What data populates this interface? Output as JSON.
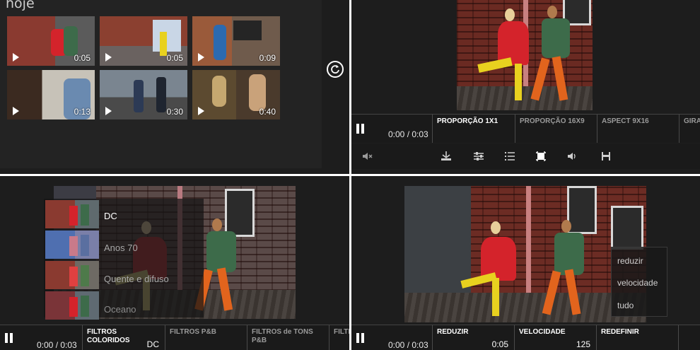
{
  "gallery": {
    "title": "hoje",
    "videos": [
      {
        "duration": "0:05"
      },
      {
        "duration": "0:05"
      },
      {
        "duration": "0:09"
      },
      {
        "duration": "0:13"
      },
      {
        "duration": "0:30"
      },
      {
        "duration": "0:40"
      }
    ],
    "refresh_icon": "refresh-icon"
  },
  "crop_editor": {
    "time": "0:00 / 0:03",
    "options": [
      "PROPORÇÃO 1X1",
      "PROPORÇÃO 16X9",
      "ASPECT 9X16",
      "GIRA"
    ],
    "tools": [
      "mute-icon",
      "trim-icon",
      "adjust-icon",
      "list-icon",
      "crop-icon",
      "volume-icon",
      "save-icon"
    ]
  },
  "filter_editor": {
    "time": "0:00 / 0:03",
    "filters": [
      "DC",
      "Anos 70",
      "Quente e difuso",
      "Oceano"
    ],
    "tabs": [
      {
        "label": "FILTROS COLORIDOS",
        "value": "DC"
      },
      {
        "label": "FILTROS P&B",
        "value": ""
      },
      {
        "label": "FILTROS de TONS P&B",
        "value": ""
      },
      {
        "label": "FILTR",
        "value": ""
      }
    ]
  },
  "speed_editor": {
    "time": "0:00 / 0:03",
    "menu": [
      "reduzir",
      "velocidade",
      "tudo"
    ],
    "tabs": [
      {
        "label": "REDUZIR",
        "value": "0:05"
      },
      {
        "label": "VELOCIDADE",
        "value": "125"
      },
      {
        "label": "REDEFINIR",
        "value": ""
      }
    ]
  },
  "colors": {
    "background": "#1d1d1d",
    "divider": "#ffffff",
    "coat": "#d4232b",
    "pants": "#e8d11f"
  }
}
